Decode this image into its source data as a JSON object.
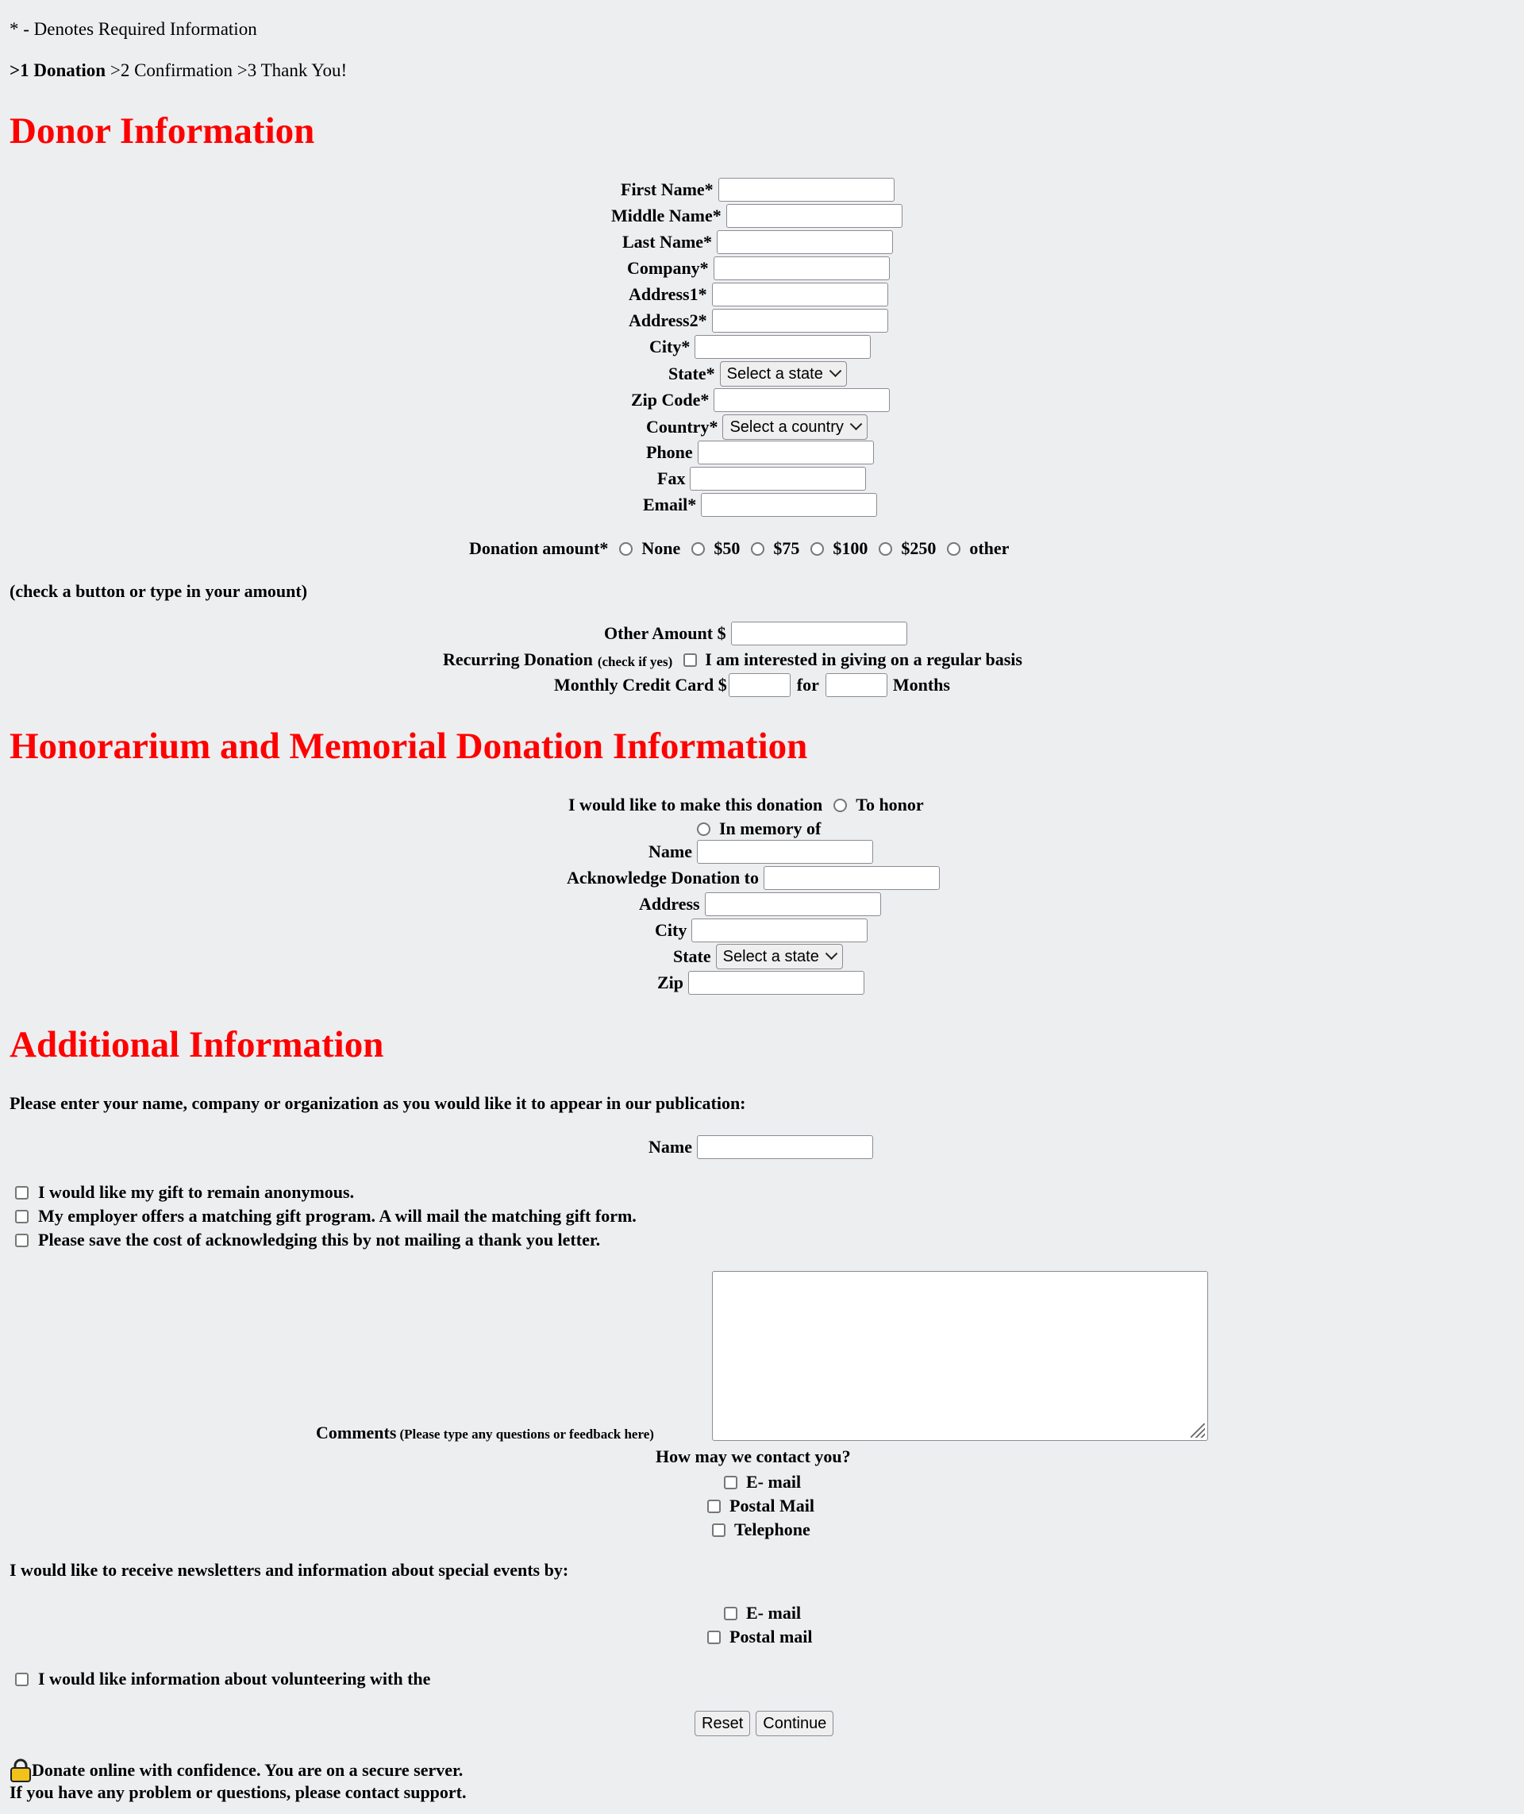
{
  "header": {
    "required_note": "* - Denotes Required Information",
    "steps_current": ">1 Donation",
    "steps_rest": " >2 Confirmation >3 Thank You!"
  },
  "donor": {
    "title": "Donor Information",
    "first_name": "First Name*",
    "middle_name": "Middle Name*",
    "last_name": "Last Name*",
    "company": "Company*",
    "address1": "Address1*",
    "address2": "Address2*",
    "city": "City*",
    "state": "State*",
    "state_select": "Select a state",
    "zip": "Zip Code*",
    "country": "Country*",
    "country_select": "Select a country",
    "phone": "Phone",
    "fax": "Fax",
    "email": "Email*"
  },
  "donation": {
    "label": "Donation amount*",
    "options": [
      "None",
      "$50",
      "$75",
      "$100",
      "$250",
      "other"
    ],
    "hint": "(check a button or type in your amount)",
    "other_amount": "Other Amount $",
    "recurring": "Recurring Donation",
    "recurring_small": "(check if yes)",
    "recurring_check": "I am interested in giving on a regular basis",
    "monthly": "Monthly Credit Card $",
    "for": "for",
    "months": "Months"
  },
  "honor": {
    "title": "Honorarium and Memorial Donation Information",
    "make_label": "I would like to make this donation",
    "to_honor": "To honor",
    "in_memory": "In memory of",
    "name": "Name",
    "acknowledge": "Acknowledge Donation to",
    "address": "Address",
    "city": "City",
    "state": "State",
    "state_select": "Select a state",
    "zip": "Zip"
  },
  "additional": {
    "title": "Additional Information",
    "publication_note": "Please enter your name, company or organization as you would like it to appear in our publication:",
    "name": "Name",
    "anonymous": "I would like my gift to remain anonymous.",
    "employer": "My employer offers a matching gift program. A will mail the matching gift form.",
    "save_cost": "Please save the cost of acknowledging this by not mailing a thank you letter.",
    "comments": "Comments",
    "comments_small": "(Please type any questions or feedback here)",
    "contact_q": "How may we contact you?",
    "contact_email": "E- mail",
    "contact_postal": "Postal Mail",
    "contact_phone": "Telephone",
    "newsletter": "I would like to receive newsletters and information about special events by:",
    "news_email": "E- mail",
    "news_postal": "Postal mail",
    "volunteer": "I would like information about volunteering with the"
  },
  "buttons": {
    "reset": "Reset",
    "continue": "Continue"
  },
  "footer": {
    "secure_icon": "lock-icon",
    "secure": "Donate online with confidence. You are on a secure server.",
    "support": "If you have any problem or questions, please contact support."
  }
}
